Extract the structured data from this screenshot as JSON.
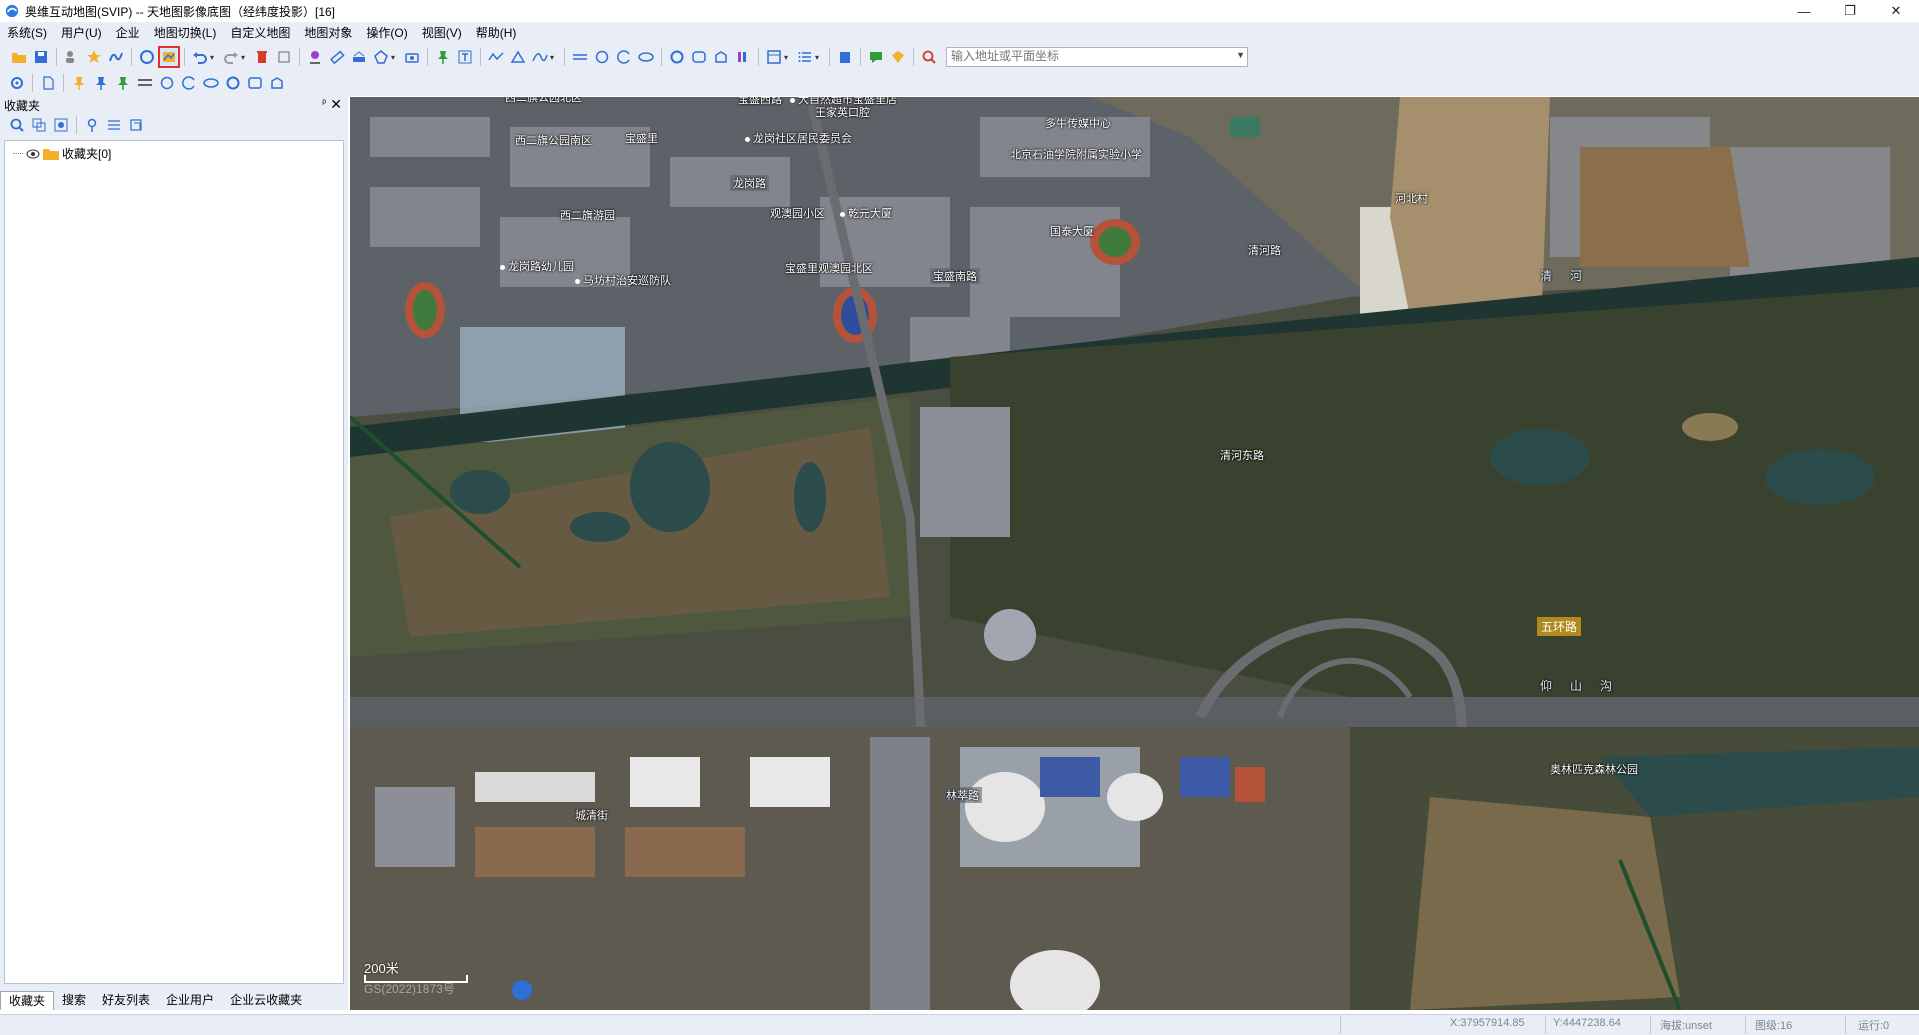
{
  "window": {
    "title": "奥维互动地图(SVIP) -- 天地图影像底图（经纬度投影）[16]",
    "minimize": "—",
    "maximize": "❐",
    "close": "✕"
  },
  "menu": [
    "系统(S)",
    "用户(U)",
    "企业",
    "地图切换(L)",
    "自定义地图",
    "地图对象",
    "操作(O)",
    "视图(V)",
    "帮助(H)"
  ],
  "search": {
    "placeholder": "输入地址或平面坐标"
  },
  "panel": {
    "title": "收藏夹",
    "pin": "ᵖ",
    "close": "✕",
    "tree_root": "收藏夹[0]",
    "tabs": [
      "收藏夹",
      "搜索",
      "好友列表",
      "企业用户",
      "企业云收藏夹"
    ],
    "selected_tab": "收藏夹"
  },
  "map": {
    "labels": {
      "l1": "西二旗公园北区",
      "l2": "宝盛西路",
      "l3": "大自然超市宝盛里店",
      "l4": "王家英口腔",
      "l5": "西二旗公园南区",
      "l6": "龙岗社区居民委员会",
      "l7": "宝盛里",
      "l8": "龙岗路",
      "l9": "多牛传媒中心",
      "l10": "北京石油学院附属实验小学",
      "l11": "西二旗游园",
      "l12": "观澳园小区",
      "l13": "乾元大厦",
      "l14": "国泰大厦",
      "l15": "龙岗路幼儿园",
      "l16": "马坊村治安巡防队",
      "l17": "宝盛里观澳园北区",
      "l18": "宝盛南路",
      "l19": "清河路",
      "l20": "河北村",
      "l21": "清河东路",
      "l22": "五环路",
      "l23": "仰山沟",
      "l24": "奥林匹克森林公园",
      "l25": "城清街",
      "l26": "林萃路",
      "l27": "清河"
    },
    "scale": "200米",
    "watermark": "GS(2022)1873号"
  },
  "status": {
    "x": "X:37957914.85",
    "y": "Y:4447238.64",
    "alt": "海拔:unset",
    "level": "图级:16",
    "run": "运行:0"
  },
  "colors": {
    "chrome": "#e9eef6",
    "active_tool_outline": "#e0302a",
    "map_base": "#3d4235"
  }
}
